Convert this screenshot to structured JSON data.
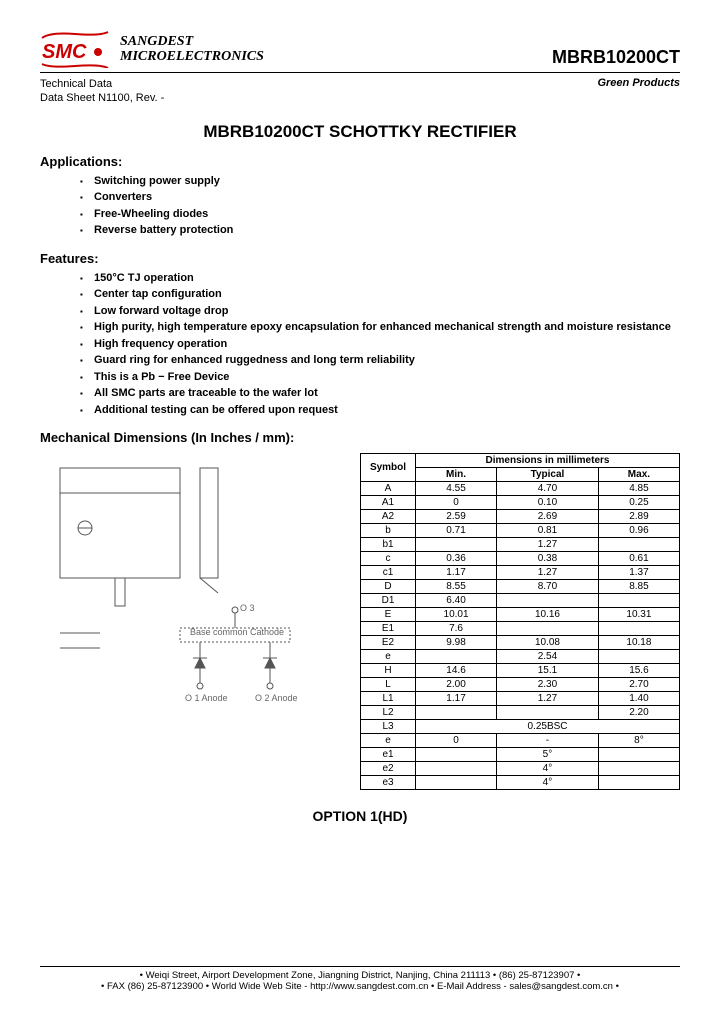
{
  "header": {
    "company_line1": "SANGDEST",
    "company_line2": "MICROELECTRONICS",
    "part_number": "MBRB10200CT"
  },
  "subhead": {
    "tech": "Technical Data",
    "ds": "Data Sheet N1100, Rev. -",
    "green": "Green Products"
  },
  "title": "MBRB10200CT SCHOTTKY RECTIFIER",
  "applications_head": "Applications:",
  "applications": [
    "Switching power supply",
    "Converters",
    "Free-Wheeling diodes",
    "Reverse battery protection"
  ],
  "features_head": "Features:",
  "features": [
    "150°C TJ operation",
    "Center tap configuration",
    "Low forward voltage drop",
    "High purity, high temperature epoxy encapsulation for enhanced mechanical strength and moisture resistance",
    "High frequency operation",
    "Guard ring for enhanced ruggedness and long term reliability",
    "This is a Pb − Free Device",
    "All SMC parts are traceable to the wafer lot",
    "Additional testing can be offered upon request"
  ],
  "mech_head": "Mechanical Dimensions (In Inches / mm):",
  "schematic": {
    "base": "Base common Cathode",
    "pin1": "O 1 Anode",
    "pin2": "O 2 Anode",
    "pin3": "O 3"
  },
  "dim_table": {
    "h_symbol": "Symbol",
    "h_dim": "Dimensions in millimeters",
    "h_min": "Min.",
    "h_typ": "Typical",
    "h_max": "Max.",
    "rows": [
      {
        "s": "A",
        "min": "4.55",
        "typ": "4.70",
        "max": "4.85"
      },
      {
        "s": "A1",
        "min": "0",
        "typ": "0.10",
        "max": "0.25"
      },
      {
        "s": "A2",
        "min": "2.59",
        "typ": "2.69",
        "max": "2.89"
      },
      {
        "s": "b",
        "min": "0.71",
        "typ": "0.81",
        "max": "0.96"
      },
      {
        "s": "b1",
        "min": "",
        "typ": "1.27",
        "max": ""
      },
      {
        "s": "c",
        "min": "0.36",
        "typ": "0.38",
        "max": "0.61"
      },
      {
        "s": "c1",
        "min": "1.17",
        "typ": "1.27",
        "max": "1.37"
      },
      {
        "s": "D",
        "min": "8.55",
        "typ": "8.70",
        "max": "8.85"
      },
      {
        "s": "D1",
        "min": "6.40",
        "typ": "",
        "max": ""
      },
      {
        "s": "E",
        "min": "10.01",
        "typ": "10.16",
        "max": "10.31"
      },
      {
        "s": "E1",
        "min": "7.6",
        "typ": "",
        "max": ""
      },
      {
        "s": "E2",
        "min": "9.98",
        "typ": "10.08",
        "max": "10.18"
      },
      {
        "s": "e",
        "min": "",
        "typ": "2.54",
        "max": ""
      },
      {
        "s": "H",
        "min": "14.6",
        "typ": "15.1",
        "max": "15.6"
      },
      {
        "s": "L",
        "min": "2.00",
        "typ": "2.30",
        "max": "2.70"
      },
      {
        "s": "L1",
        "min": "1.17",
        "typ": "1.27",
        "max": "1.40"
      },
      {
        "s": "L2",
        "min": "",
        "typ": "",
        "max": "2.20"
      },
      {
        "s": "L3",
        "min": "",
        "typ": "0.25BSC",
        "max": ""
      },
      {
        "s": "e",
        "min": "0",
        "typ": "-",
        "max": "8°"
      },
      {
        "s": "e1",
        "min": "",
        "typ": "5°",
        "max": ""
      },
      {
        "s": "e2",
        "min": "",
        "typ": "4°",
        "max": ""
      },
      {
        "s": "e3",
        "min": "",
        "typ": "4°",
        "max": ""
      }
    ]
  },
  "option": "OPTION 1(HD)",
  "footer": {
    "line1": "• Weiqi Street, Airport Development Zone, Jiangning District, Nanjing, China 211113  • (86) 25-87123907 •",
    "line2": "• FAX (86) 25-87123900 • World Wide Web Site - http://www.sangdest.com.cn • E-Mail Address - sales@sangdest.com.cn •"
  }
}
